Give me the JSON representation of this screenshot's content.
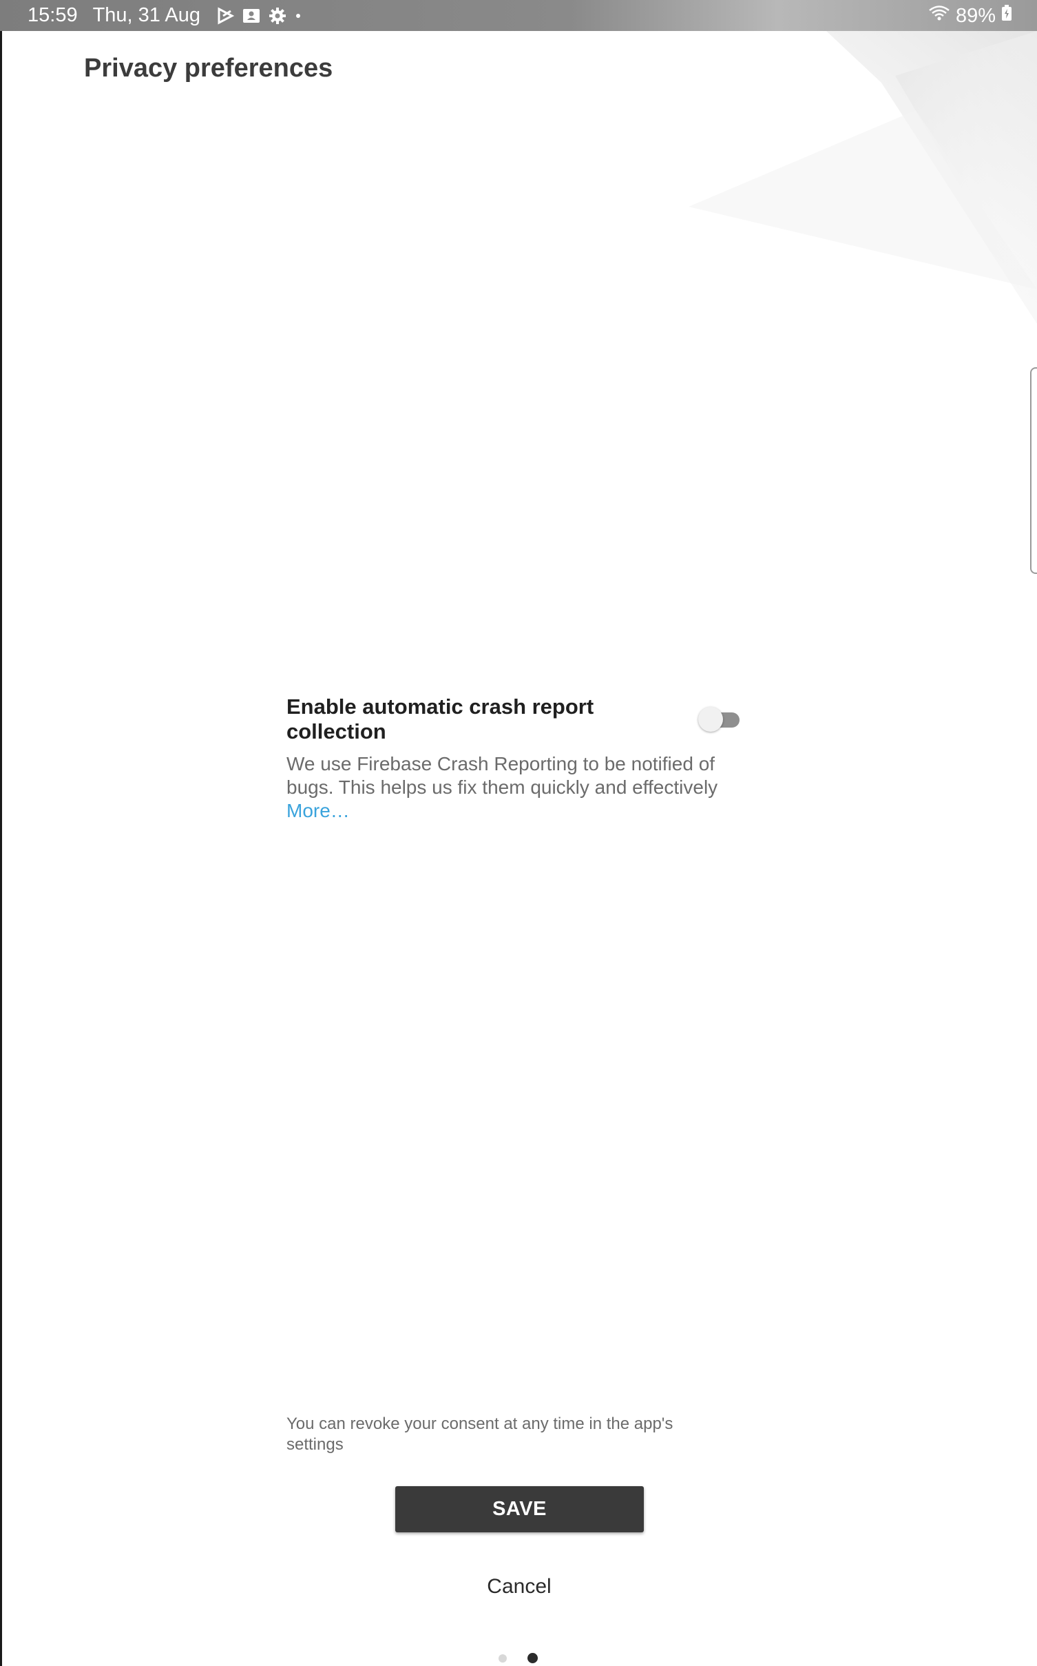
{
  "status_bar": {
    "time": "15:59",
    "date": "Thu, 31 Aug",
    "notification_icons": [
      "play-store-icon",
      "contact-card-icon",
      "settings-gear-icon",
      "more-dot-icon"
    ],
    "wifi_icon": "wifi-icon",
    "battery_percent": "89%",
    "battery_icon": "battery-charging-icon"
  },
  "header": {
    "title": "Privacy preferences"
  },
  "crash_setting": {
    "title": "Enable automatic crash report collection",
    "enabled": false,
    "description": "We use Firebase Crash Reporting to be notified of bugs. This helps us fix them quickly and effectively",
    "more_link": "More…"
  },
  "footer": {
    "revoke_note": "You can revoke your consent at any time in the app's settings",
    "save_label": "SAVE",
    "cancel_label": "Cancel"
  },
  "pager": {
    "total_pages": 2,
    "current_page": 2
  },
  "colors": {
    "link": "#3aa3dc",
    "button_bg": "#3a3a3a",
    "title_text": "#3c3c3c",
    "toggle_off_track": "#8f8f8f"
  }
}
